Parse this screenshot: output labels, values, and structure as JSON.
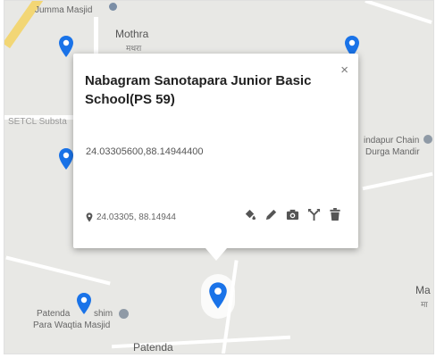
{
  "map": {
    "labels": {
      "jumma": "Jumma Masjid",
      "mothra": "Mothra",
      "mothra_local": "मथरा",
      "setcl": "SETCL Substa",
      "chaindapur": "indapur Chain",
      "durga": "Durga Mandir",
      "patenda_mosque_1": "Patenda",
      "patenda_mosque_1b": "shim",
      "patenda_mosque_2": "Para Waqtia Masjid",
      "patenda": "Patenda",
      "ma": "Ma",
      "ma_local": "मा"
    }
  },
  "popup": {
    "title": "Nabagram Sanotapara Junior Basic School(PS 59)",
    "close_label": "×",
    "coordinates": "24.03305600,88.14944400",
    "footer_coords": "24.03305, 88.14944"
  },
  "icons": {
    "close": "close-icon",
    "location": "location-pin-icon",
    "fill": "paint-bucket-icon",
    "edit": "pencil-icon",
    "photo": "camera-icon",
    "route": "route-fork-icon",
    "delete": "trash-icon"
  },
  "colors": {
    "marker": "#1a73e8",
    "land": "#e8e8e5",
    "road": "#ffffff",
    "highway": "#f2d675"
  }
}
